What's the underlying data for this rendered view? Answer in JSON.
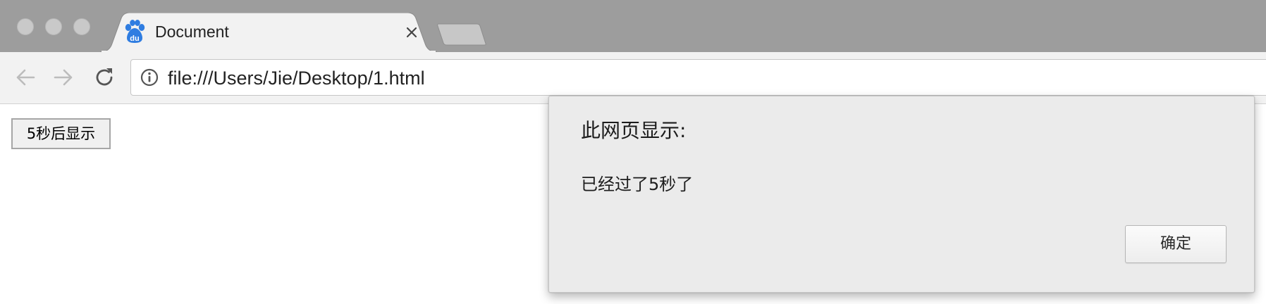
{
  "window": {
    "traffic_lights": [
      "close",
      "minimize",
      "zoom"
    ]
  },
  "tab": {
    "title": "Document",
    "favicon": "baidu-paw-icon",
    "close_icon": "close-icon"
  },
  "toolbar": {
    "back_icon": "arrow-left-icon",
    "forward_icon": "arrow-right-icon",
    "reload_icon": "reload-icon",
    "info_icon": "info-icon",
    "url": "file:///Users/Jie/Desktop/1.html"
  },
  "page": {
    "button_label": "5秒后显示"
  },
  "dialog": {
    "title": "此网页显示:",
    "message": "已经过了5秒了",
    "ok_label": "确定"
  },
  "colors": {
    "titlebar": "#9d9d9d",
    "toolbar": "#f2f2f2",
    "tab_active": "#f2f2f2",
    "favicon_blue": "#2f7de1",
    "dialog_background": "#ebebeb"
  }
}
